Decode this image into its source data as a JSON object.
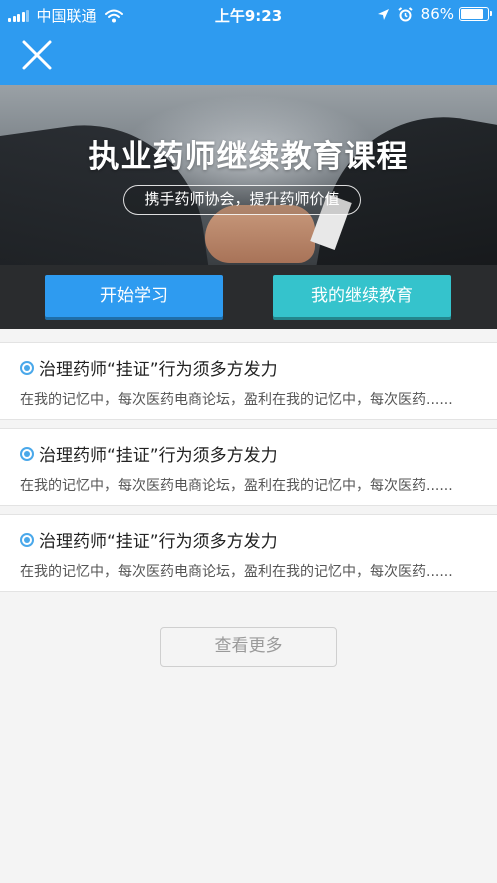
{
  "status_bar": {
    "carrier": "中国联通",
    "time": "上午9:23",
    "battery_text": "86%",
    "battery_level": 0.86
  },
  "header": {
    "close_icon": "close-icon"
  },
  "banner": {
    "title": "执业药师继续教育课程",
    "subtitle": "携手药师协会，提升药师价值"
  },
  "actions": {
    "start_label": "开始学习",
    "mine_label": "我的继续教育"
  },
  "articles": [
    {
      "title": "治理药师“挂证”行为须多方发力",
      "summary": "在我的记忆中，每次医药电商论坛，盈利在我的记忆中，每次医药......"
    },
    {
      "title": "治理药师“挂证”行为须多方发力",
      "summary": "在我的记忆中，每次医药电商论坛，盈利在我的记忆中，每次医药......"
    },
    {
      "title": "治理药师“挂证”行为须多方发力",
      "summary": "在我的记忆中，每次医药电商论坛，盈利在我的记忆中，每次医药......"
    }
  ],
  "more_label": "查看更多",
  "colors": {
    "header_blue": "#2e9bf0",
    "start_button": "#2e9bf0",
    "mine_button": "#35c3cc",
    "bullet": "#4aa8ea"
  }
}
